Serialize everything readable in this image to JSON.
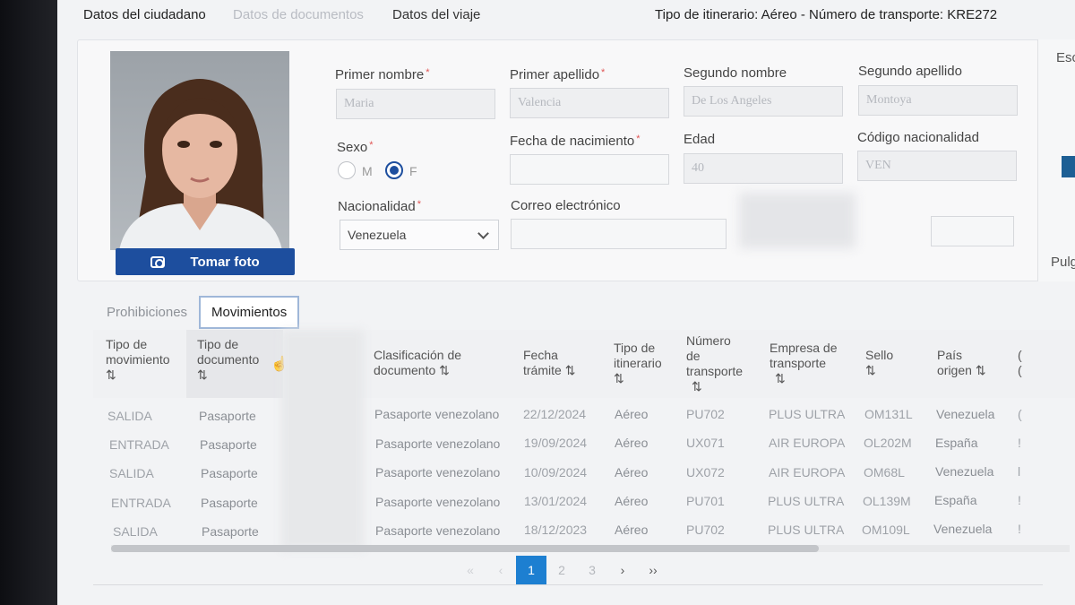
{
  "topnav": {
    "tabs": [
      {
        "label": "Datos del ciudadano",
        "state": "active"
      },
      {
        "label": "Datos de documentos",
        "state": "disabled"
      },
      {
        "label": "Datos del viaje",
        "state": "normal"
      }
    ],
    "itinerary_info": "Tipo de itinerario: Aéreo - Número de transporte: KRE272"
  },
  "citizen": {
    "photo_button": "Tomar foto",
    "first_name": {
      "label": "Primer nombre",
      "value": "Maria"
    },
    "first_surname": {
      "label": "Primer apellido",
      "value": "Valencia"
    },
    "second_name": {
      "label": "Segundo nombre",
      "value": "De Los Angeles"
    },
    "second_surname": {
      "label": "Segundo apellido",
      "value": "Montoya"
    },
    "sex": {
      "label": "Sexo",
      "options": [
        "M",
        "F"
      ],
      "selected": "F"
    },
    "birth_date": {
      "label": "Fecha de nacimiento",
      "value": ""
    },
    "age": {
      "label": "Edad",
      "value": "40"
    },
    "nationality_code": {
      "label": "Código nacionalidad",
      "value": "VEN"
    },
    "nationality": {
      "label": "Nacionalidad",
      "value": "Venezuela"
    },
    "email": {
      "label": "Correo electrónico",
      "value": ""
    }
  },
  "sidebox": {
    "top_label": "Esc",
    "bottom_label": "Pulg"
  },
  "subtabs": {
    "prohibitions": "Prohibiciones",
    "movements": "Movimientos"
  },
  "table": {
    "headers": {
      "movement_type": [
        "Tipo de",
        "movimiento"
      ],
      "document_type": [
        "Tipo de",
        "documento"
      ],
      "doc_class": [
        "Clasificación de",
        "documento"
      ],
      "date": [
        "Fecha",
        "trámite"
      ],
      "itinerary": [
        "Tipo de",
        "itinerario"
      ],
      "transport_no": [
        "Número",
        "de",
        "transporte"
      ],
      "company": [
        "Empresa de",
        "transporte"
      ],
      "stamp": [
        "Sello"
      ],
      "origin": [
        "País",
        "origen"
      ],
      "cut": [
        "(",
        "("
      ]
    },
    "sort_icon": "⇅",
    "rows": [
      {
        "movement": "SALIDA",
        "doc": "Pasaporte",
        "class": "Pasaporte venezolano",
        "date": "22/12/2024",
        "itin": "Aéreo",
        "transport": "PU702",
        "company": "PLUS ULTRA",
        "stamp": "OM131L",
        "origin": "Venezuela",
        "cut": "("
      },
      {
        "movement": "ENTRADA",
        "doc": "Pasaporte",
        "class": "Pasaporte venezolano",
        "date": "19/09/2024",
        "itin": "Aéreo",
        "transport": "UX071",
        "company": "AIR EUROPA",
        "stamp": "OL202M",
        "origin": "España",
        "cut": "!"
      },
      {
        "movement": "SALIDA",
        "doc": "Pasaporte",
        "class": "Pasaporte venezolano",
        "date": "10/09/2024",
        "itin": "Aéreo",
        "transport": "UX072",
        "company": "AIR EUROPA",
        "stamp": "OM68L",
        "origin": "Venezuela",
        "cut": "l"
      },
      {
        "movement": "ENTRADA",
        "doc": "Pasaporte",
        "class": "Pasaporte venezolano",
        "date": "13/01/2024",
        "itin": "Aéreo",
        "transport": "PU701",
        "company": "PLUS ULTRA",
        "stamp": "OL139M",
        "origin": "España",
        "cut": "!"
      },
      {
        "movement": "SALIDA",
        "doc": "Pasaporte",
        "class": "Pasaporte venezolano",
        "date": "18/12/2023",
        "itin": "Aéreo",
        "transport": "PU702",
        "company": "PLUS ULTRA",
        "stamp": "OM109L",
        "origin": "Venezuela",
        "cut": "!"
      }
    ]
  },
  "pagination": {
    "first": "«",
    "prev": "‹",
    "pages": [
      "1",
      "2",
      "3"
    ],
    "current": "1",
    "next": "›",
    "last": "››"
  },
  "icons": {
    "camera": "camera-icon",
    "chevron": "chevron-down-icon",
    "sort": "sort-icon",
    "cursor": "hand-cursor-icon"
  },
  "colors": {
    "primary": "#1d4e9e",
    "pager_active": "#1d7fd1",
    "required": "#e05555"
  }
}
